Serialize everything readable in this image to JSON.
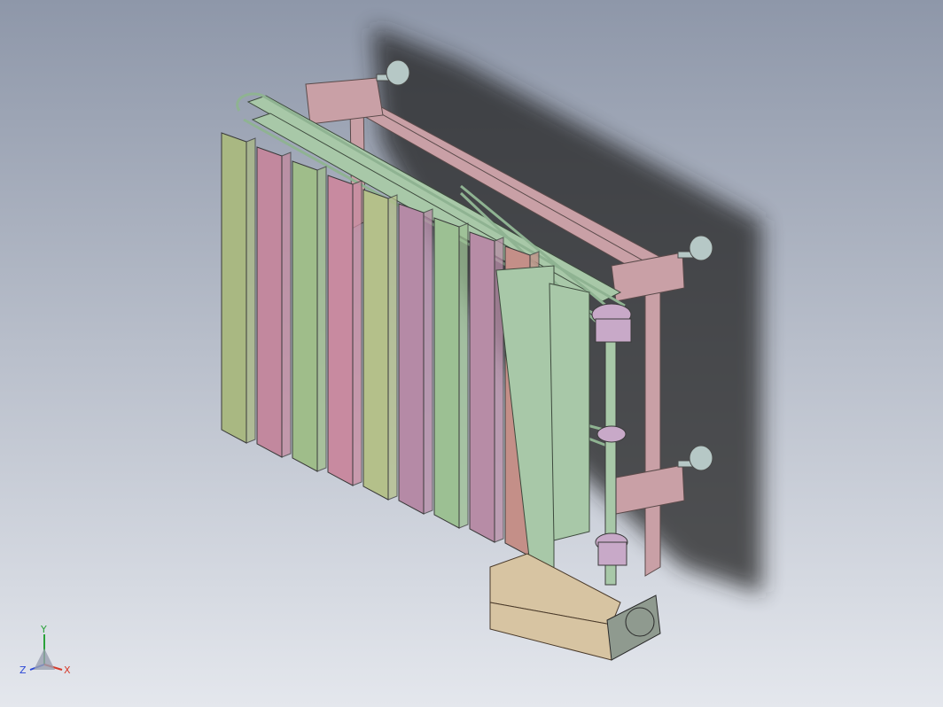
{
  "viewport": {
    "background_top": "#8e97a9",
    "background_bottom": "#e4e7ed"
  },
  "parts": {
    "slat_colors": [
      "#a9b882",
      "#c2889e",
      "#9fbd8a",
      "#c88aa0",
      "#b4c08a",
      "#b58aa6",
      "#9cc093",
      "#b78ca6",
      "#c48f88"
    ],
    "frame_color": "#c9a0a6",
    "rail_color": "#a8c8a8",
    "belt_color": "#8fb392",
    "pulley_color": "#c8a9c8",
    "base_color": "#d7c4a2",
    "motor_color": "#8f9a8f",
    "post_color": "#b6c8c6"
  },
  "triad": {
    "y_label": "Y",
    "z_label": "Z",
    "x_label": "X",
    "y_color": "#2aa23a",
    "z_color": "#2b47d6",
    "x_color": "#d63b2b"
  }
}
